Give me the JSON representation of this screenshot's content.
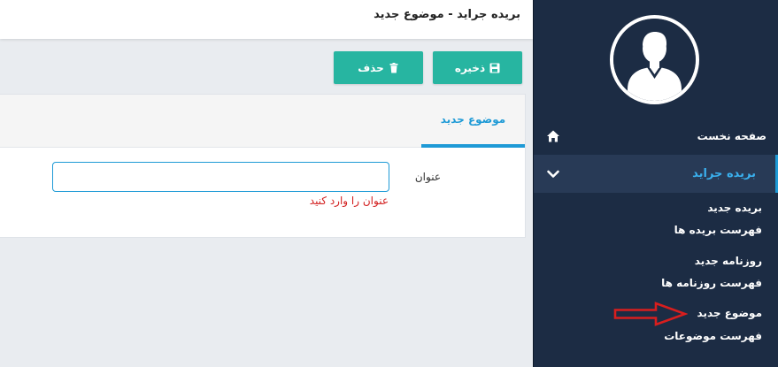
{
  "header": {
    "title": "بریده جراید - موضوع جدید"
  },
  "toolbar": {
    "save_label": "ذخیره",
    "save_icon": "floppy-disk-icon",
    "delete_label": "حذف",
    "delete_icon": "trash-icon"
  },
  "tabs": [
    {
      "label": "موضوع جدید",
      "active": true
    }
  ],
  "form": {
    "title_label": "عنوان",
    "title_value": "",
    "title_placeholder": "",
    "title_error": "عنوان را وارد کنید"
  },
  "sidebar": {
    "avatar_icon": "user-avatar-icon",
    "home": {
      "label": "صفحه نخست",
      "icon": "home-icon"
    },
    "section": {
      "label": "بریده جراید",
      "icon": "chevron-down-icon",
      "expanded": true
    },
    "items": [
      {
        "label": "بریده جدید"
      },
      {
        "label": "فهرست بریده ها"
      },
      {
        "label": "روزنامه جدید"
      },
      {
        "label": "فهرست روزنامه ها"
      },
      {
        "label": "موضوع جدید"
      },
      {
        "label": "فهرست موضوعات"
      }
    ]
  },
  "colors": {
    "sidebar_bg": "#1c2c44",
    "accent": "#1e9ad6",
    "button": "#27b5a1",
    "error": "#d21f1f",
    "annotation": "#d81e1e"
  }
}
